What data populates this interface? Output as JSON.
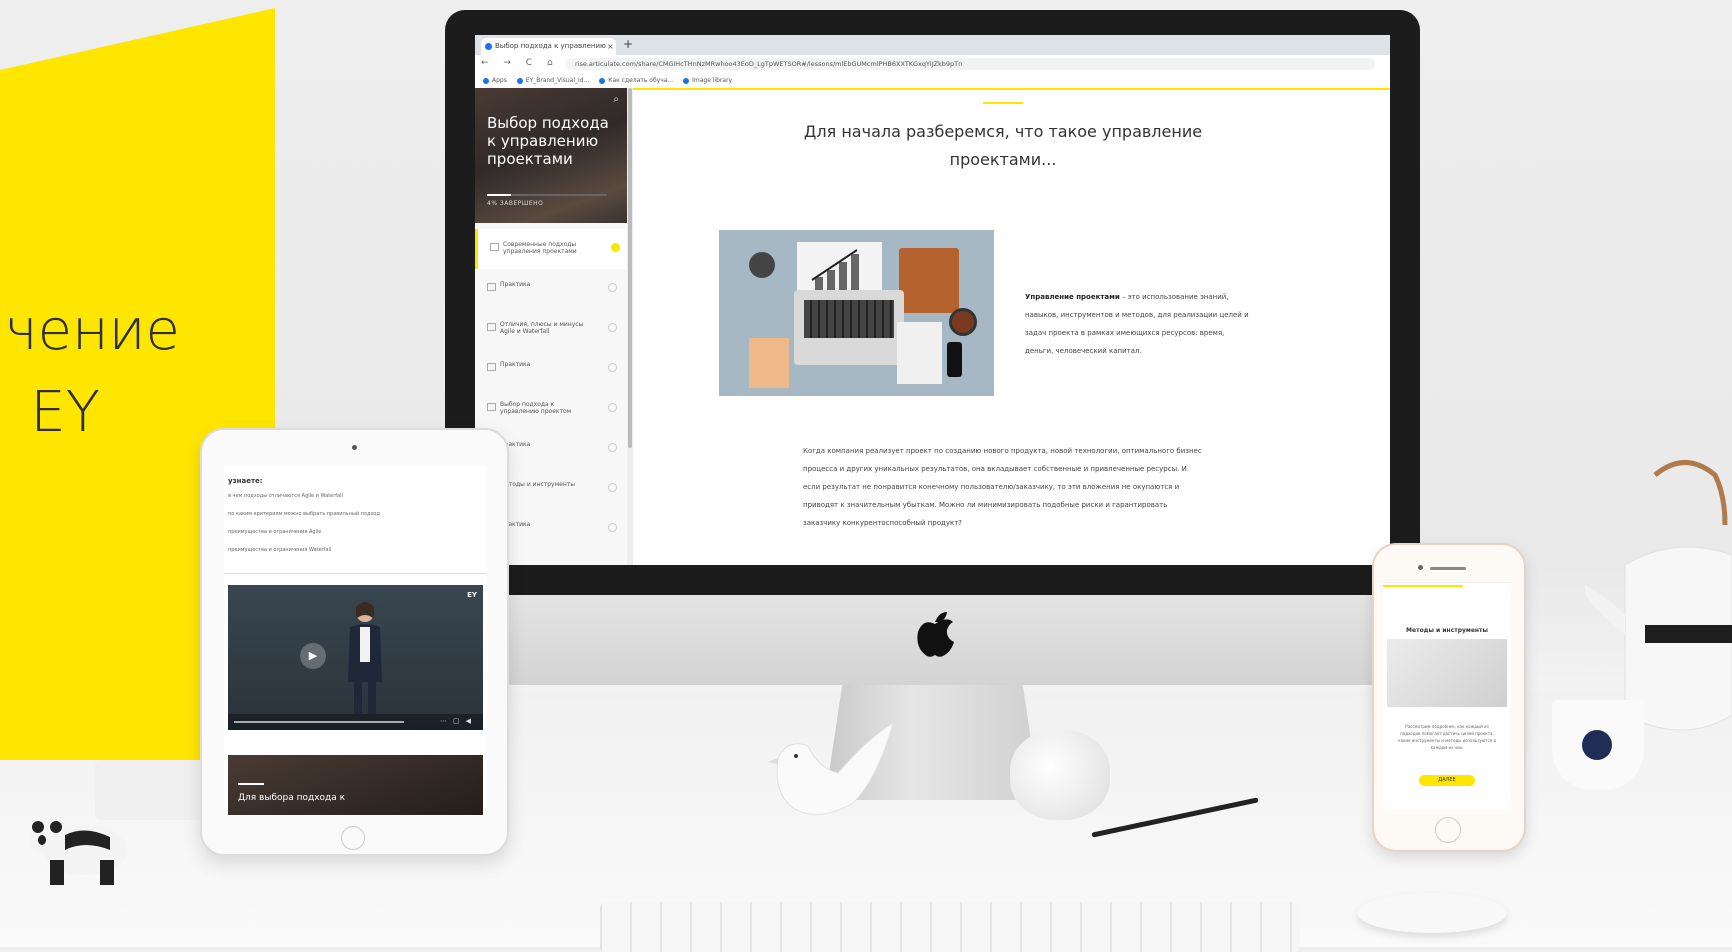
{
  "banner": {
    "line1": "чение",
    "line2": "EY",
    "color": "#ffe600"
  },
  "browser": {
    "tab_title": "Выбор подхода к управлению",
    "tab_close": "×",
    "new_tab": "+",
    "nav": "← → C ⌂",
    "url": "rise.articulate.com/share/CMGiHcTHnNzMRwhoo43EoD_LgTpWETSOR#/lessons/mlEbGUMcmlPHB6XXTKGxqYiJZkb9pTn",
    "bookmarks": [
      "Apps",
      "EY_Brand_Visual_Id...",
      "Как сделать обуча...",
      "Image library"
    ]
  },
  "course": {
    "title": "Выбор подхода к управлению проектами",
    "progress_label": "4% ЗАВЕРШЕНО",
    "progress_fraction": 0.2,
    "lessons": [
      {
        "label": "Современные подходы управления проектами",
        "active": true
      },
      {
        "label": "Практика",
        "active": false
      },
      {
        "label": "Отличия, плюсы и минусы Agile и Waterfall",
        "active": false
      },
      {
        "label": "Практика",
        "active": false
      },
      {
        "label": "Выбор подхода к управлению проектом",
        "active": false
      },
      {
        "label": "Практика",
        "active": false
      },
      {
        "label": "Методы и инструменты",
        "active": false
      },
      {
        "label": "Практика",
        "active": false
      }
    ]
  },
  "main": {
    "heading": "Для начала разберемся, что такое управление проектами...",
    "definition_term": "Управление проектами",
    "definition_text": " – это использование знаний, навыков, инструментов и методов, для реализации целей и задач проекта в рамках имеющихся ресурсов: время, деньги, человеческий капитал.",
    "paragraph": "Когда компания реализует проект по созданию нового продукта, новой технологии, оптимального бизнес процесса и других уникальных результатов, она вкладывает собственные и привлеченные ресурсы. И если результат не понравится конечному пользователю/заказчику, то эти вложения не окупаются и приводят к значительным убыткам. Можно ли минимизировать подобные риски и гарантировать заказчику конкурентоспособный продукт?"
  },
  "ipad": {
    "heading": "узнаете:",
    "items": [
      "в чем подходы отличаются Agile и Waterfall",
      "по каким критериям можно выбрать правильный подход",
      "преимущества и ограничения Agile",
      "преимущества и ограничения Waterfall"
    ],
    "video_logo": "EY",
    "play_icon": "▶",
    "card_text": "Для выбора подхода к"
  },
  "iphone": {
    "title": "Методы и инструменты",
    "text": "Рассмотрим подробнее, как каждый из подходов помогает достичь целей проекта, какие инструменты и методы используются в каждом из них.",
    "button": "ДАЛЕЕ"
  }
}
